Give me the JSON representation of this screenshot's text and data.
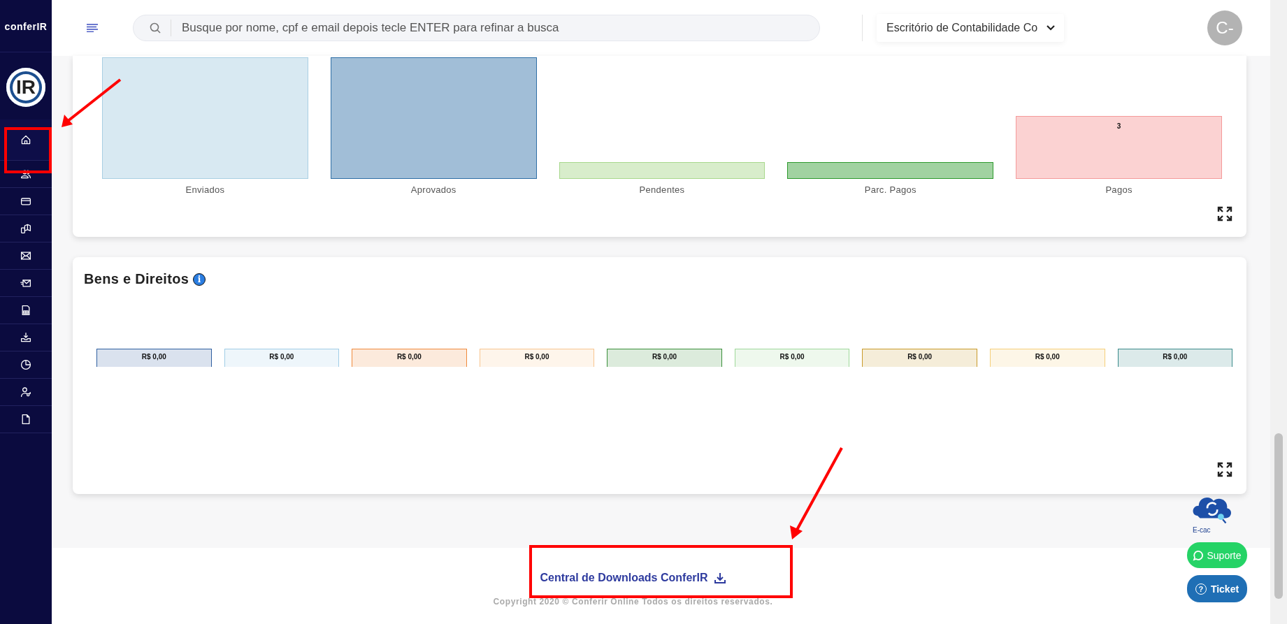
{
  "sidebar": {
    "logo_text": "conferIR",
    "logo_badge": "IR",
    "items": [
      {
        "selected": true
      },
      {
        "selected": false
      },
      {
        "selected": false
      },
      {
        "selected": false
      },
      {
        "selected": false
      },
      {
        "selected": false
      },
      {
        "selected": false
      },
      {
        "selected": false
      },
      {
        "selected": false
      },
      {
        "selected": false
      },
      {
        "selected": false
      }
    ]
  },
  "header": {
    "search": {
      "placeholder": "Busque por nome, cpf e email depois tecle ENTER para refinar a busca"
    },
    "office_select": "Escritório de Contabilidade Co",
    "avatar": "C-"
  },
  "status_card": {
    "chart_data": {
      "type": "bar",
      "categories": [
        "Enviados",
        "Aprovados",
        "Pendentes",
        "Parc. Pagos",
        "Pagos"
      ],
      "values": [
        5.8,
        5.8,
        0.8,
        0.8,
        3
      ],
      "value_labels": [
        null,
        null,
        null,
        null,
        "3"
      ]
    }
  },
  "bens_card": {
    "title": "Bens e Direitos",
    "info_badge": "i",
    "items": [
      {
        "value": "R$ 0,00",
        "color": "#2f5fa0"
      },
      {
        "value": "R$ 0,00",
        "color": "#a0cde6"
      },
      {
        "value": "R$ 0,00",
        "color": "#f08a3c"
      },
      {
        "value": "R$ 0,00",
        "color": "#f8c590"
      },
      {
        "value": "R$ 0,00",
        "color": "#3a8f3a"
      },
      {
        "value": "R$ 0,00",
        "color": "#9fd89a"
      },
      {
        "value": "R$ 0,00",
        "color": "#c99a2a"
      },
      {
        "value": "R$ 0,00",
        "color": "#f5cf7a"
      },
      {
        "value": "R$ 0,00",
        "color": "#3b8b8b"
      }
    ]
  },
  "footer": {
    "downloads_link": "Central de Downloads ConferIR",
    "copyright": "Copyright 2020 © Conferir Online Todos os direitos reservados."
  },
  "floating": {
    "ecac_label": "E-cac",
    "support_button": "Suporte",
    "ticket_button": "Ticket",
    "ticket_badge": "?"
  }
}
